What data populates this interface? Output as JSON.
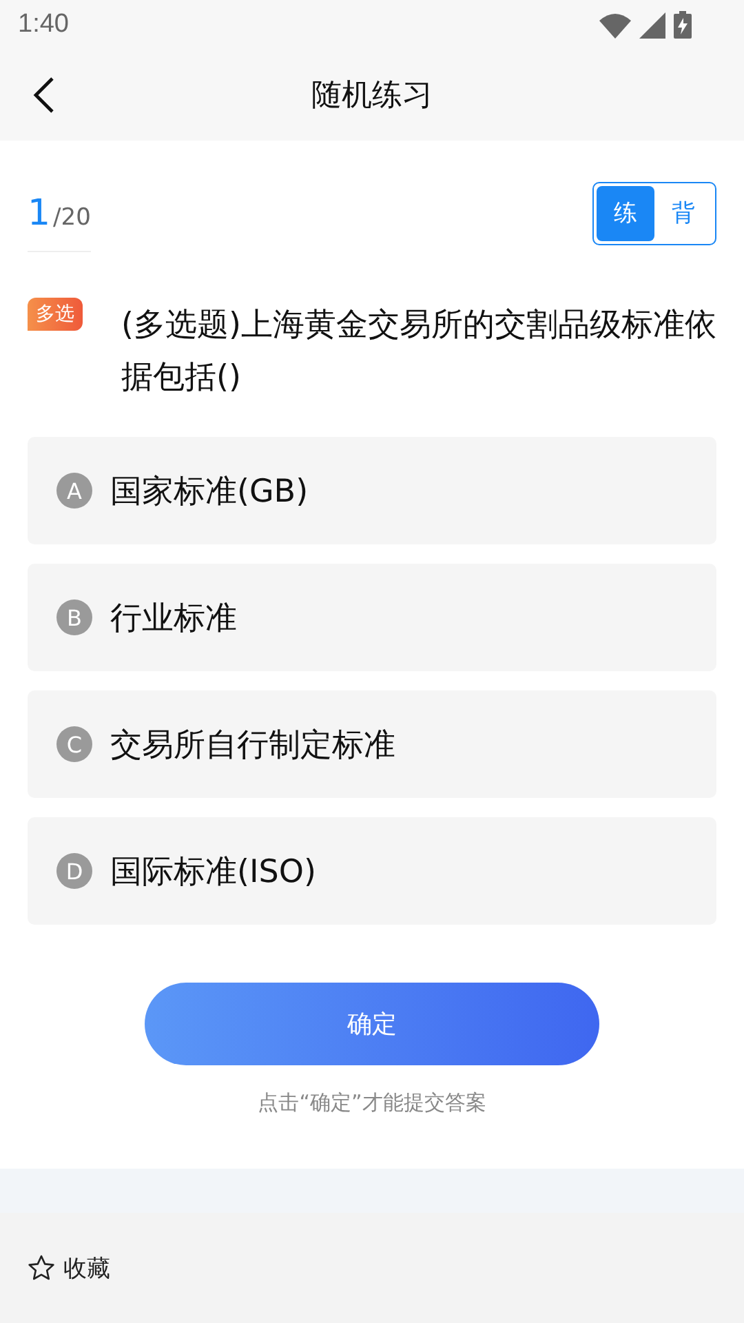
{
  "status_bar": {
    "time": "1:40"
  },
  "header": {
    "title": "随机练习"
  },
  "progress": {
    "current": "1",
    "total": "/20"
  },
  "mode_tabs": [
    {
      "label": "练",
      "selected": true
    },
    {
      "label": "背",
      "selected": false
    }
  ],
  "question": {
    "tag": "多选",
    "text": "(多选题)上海黄金交易所的交割品级标准依据包括()"
  },
  "options": [
    {
      "letter": "A",
      "text": "国家标准(GB)",
      "selected": false
    },
    {
      "letter": "B",
      "text": "行业标准",
      "selected": false
    },
    {
      "letter": "C",
      "text": "交易所自行制定标准",
      "selected": false
    },
    {
      "letter": "D",
      "text": "国际标准(ISO)",
      "selected": false
    }
  ],
  "confirm_button": "确定",
  "hint": "点击“确定”才能提交答案",
  "bottom_bar": {
    "favorite": "收藏"
  }
}
